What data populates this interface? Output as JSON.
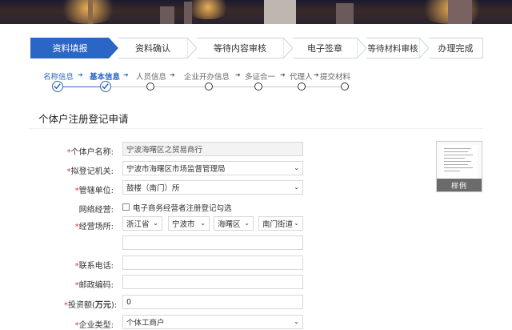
{
  "flow_steps": [
    {
      "label": "资料填报",
      "active": true
    },
    {
      "label": "资料确认",
      "active": false
    },
    {
      "label": "等待内容审核",
      "active": false
    },
    {
      "label": "电子签章",
      "active": false
    },
    {
      "label": "等待材料审核",
      "active": false
    },
    {
      "label": "办理完成",
      "active": false
    }
  ],
  "sub_steps": [
    {
      "label": "名称信息",
      "state": "done"
    },
    {
      "label": "基本信息",
      "state": "current"
    },
    {
      "label": "人员信息",
      "state": "todo"
    },
    {
      "label": "企业开办信息",
      "state": "todo"
    },
    {
      "label": "多证合一",
      "state": "todo"
    },
    {
      "label": "代理人",
      "state": "todo"
    },
    {
      "label": "提交材料",
      "state": "todo"
    }
  ],
  "section_title": "个体户注册登记申请",
  "form": {
    "name_label": "个体户名称:",
    "name_value": "宁波海曙区之贸易商行",
    "authority_label": "拟登记机关:",
    "authority_value": "宁波市海曙区市场监督管理局",
    "unit_label": "管辖单位:",
    "unit_value": "鼓楼（南门）所",
    "online_label": "网络经营:",
    "online_check_text": "电子商务经营者注册登记勾选",
    "place_label": "经营场所:",
    "place_province": "浙江省",
    "place_city": "宁波市",
    "place_district": "海曙区",
    "place_street": "南门街道",
    "phone_label": "联系电话:",
    "postcode_label": "邮政编码:",
    "investment_label_prefix": "投资额(",
    "investment_label_unit": "万元",
    "investment_label_suffix": "):",
    "investment_value": "0",
    "type_label": "企业类型:",
    "type_value": "个体工商户",
    "required_mark": "*"
  },
  "sample_label": "样例",
  "icons": {
    "chevron": "chevron-down-icon",
    "step_arrow": "arrow-right-icon",
    "check": "check-icon"
  },
  "colors": {
    "accent": "#2a66c6",
    "required": "#dd3333"
  }
}
